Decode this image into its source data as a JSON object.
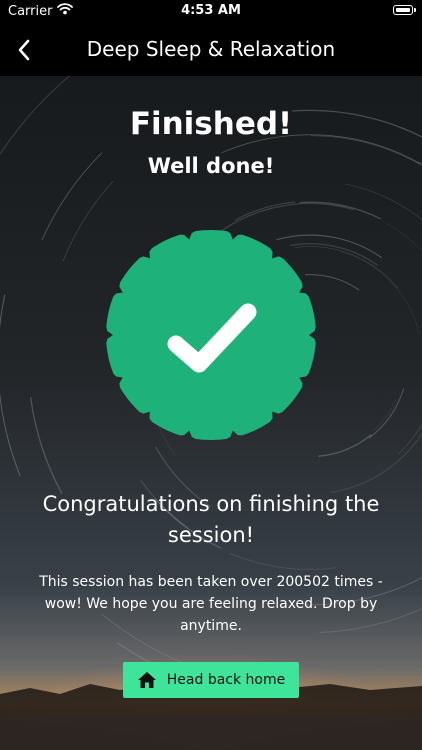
{
  "status_bar": {
    "carrier": "Carrier",
    "time": "4:53 AM",
    "icons": [
      "wifi-icon",
      "battery-icon"
    ]
  },
  "nav": {
    "title": "Deep Sleep & Relaxation",
    "back_icon": "chevron-left-icon"
  },
  "main": {
    "title": "Finished!",
    "subtitle": "Well done!",
    "badge_icon": "checkmark-icon",
    "congrats": "Congratulations on finishing the session!",
    "description": "This session has been taken over 200502 times - wow! We hope you are feeling relaxed. Drop by anytime.",
    "home_button": {
      "label": "Head back home",
      "icon": "home-icon"
    }
  },
  "colors": {
    "accent": "#3ee49a",
    "badge": "#1fb17a",
    "bars": "#000000"
  }
}
